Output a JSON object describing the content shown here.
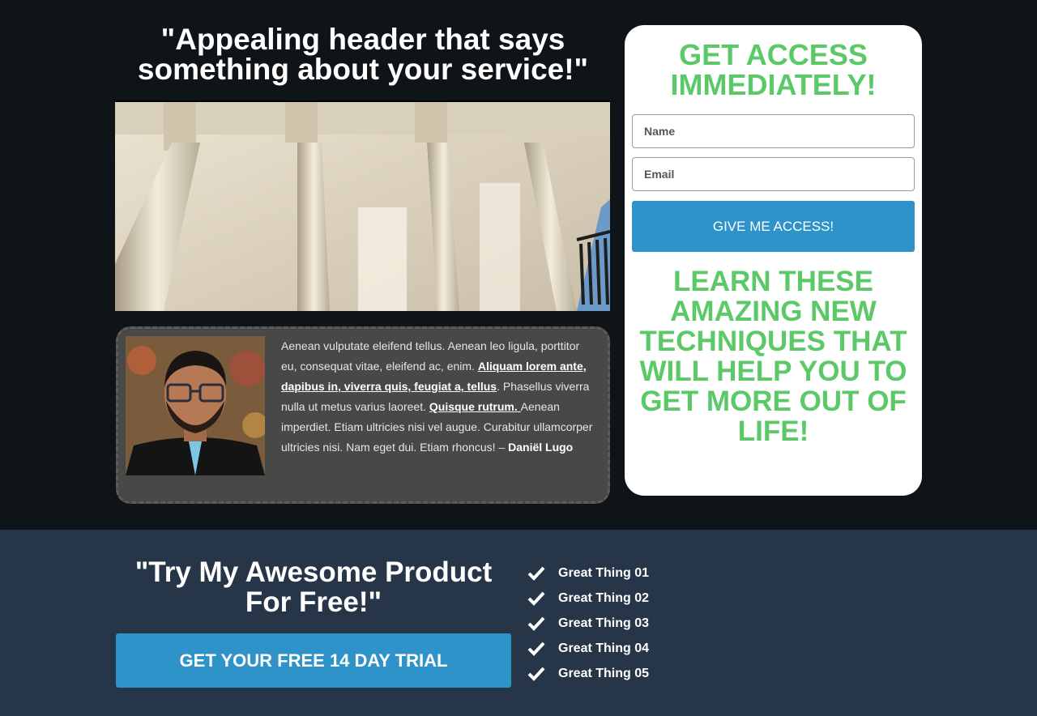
{
  "hero": {
    "headline": "\"Appealing header that says something about your service!\""
  },
  "testimonial": {
    "text_1": "Aenean vulputate eleifend tellus. Aenean leo ligula, porttitor eu, consequat vitae, eleifend ac, enim. ",
    "link_1": "Aliquam lorem ante, dapibus in, viverra quis, feugiat a, tellus",
    "text_2": ". Phasellus viverra nulla ut metus varius laoreet. ",
    "link_2": "Quisque rutrum. ",
    "text_3": "Aenean imperdiet. Etiam ultricies nisi vel augue. Curabitur ullamcorper ultricies nisi. Nam eget dui. Etiam rhoncus! – ",
    "author": "Daniël Lugo"
  },
  "signup": {
    "title": "GET ACCESS IMMEDIATELY!",
    "name_placeholder": "Name",
    "email_placeholder": "Email",
    "button_label": "GIVE ME ACCESS!",
    "promo": "LEARN THESE AMAZING NEW TECHNIQUES THAT WILL HELP YOU TO GET MORE OUT OF LIFE!"
  },
  "offer": {
    "title": "\"Try My Awesome Product For Free!\"",
    "button_label": "GET YOUR FREE 14 DAY TRIAL",
    "benefits": [
      "Great Thing 01",
      "Great Thing 02",
      "Great Thing 03",
      "Great Thing 04",
      "Great Thing 05"
    ]
  },
  "colors": {
    "hero_bg": "#0f1419",
    "footer_bg": "#263548",
    "accent_blue": "#2e93c9",
    "accent_green": "#5cc968",
    "testimonial_bg": "#484848"
  },
  "icons": {
    "benefit": "check-icon"
  }
}
